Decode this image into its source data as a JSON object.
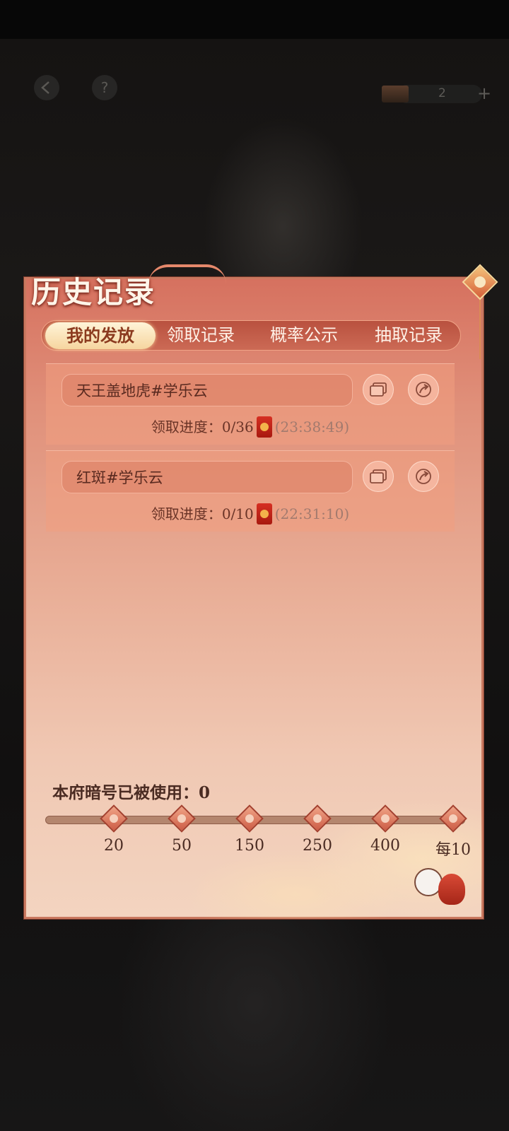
{
  "hud": {
    "help_symbol": "?",
    "count": "2",
    "plus_symbol": "+"
  },
  "panel": {
    "title": "历史记录"
  },
  "tabs": [
    {
      "label": "我的发放",
      "active": true
    },
    {
      "label": "领取记录",
      "active": false
    },
    {
      "label": "概率公示",
      "active": false
    },
    {
      "label": "抽取记录",
      "active": false
    }
  ],
  "records": [
    {
      "name": "天王盖地虎#学乐云",
      "progress_label": "领取进度：",
      "progress": "0/36",
      "time": "(23:38:49)"
    },
    {
      "name": "红斑#学乐云",
      "progress_label": "领取进度：",
      "progress": "0/10",
      "time": "(22:31:10)"
    }
  ],
  "milestones": {
    "usage_label": "本府暗号已被使用：0",
    "used": 0,
    "labels": [
      "20",
      "50",
      "150",
      "250",
      "400",
      "每10"
    ]
  },
  "colors": {
    "accent": "#d6715f",
    "tab_active": "#f6d59f",
    "text_dark": "#4a2b22",
    "envelope_red": "#c4241a"
  },
  "icons": {
    "back": "back-arrow-icon",
    "help": "question-icon",
    "copy": "copy-icon",
    "share": "share-arrow-icon",
    "envelope": "red-envelope-icon"
  }
}
